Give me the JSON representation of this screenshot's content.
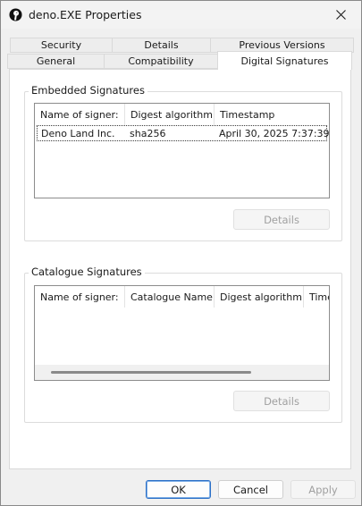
{
  "window": {
    "title": "deno.EXE Properties"
  },
  "tabs": {
    "row1": [
      {
        "label": "Security"
      },
      {
        "label": "Details"
      },
      {
        "label": "Previous Versions"
      }
    ],
    "row2": [
      {
        "label": "General"
      },
      {
        "label": "Compatibility"
      },
      {
        "label": "Digital Signatures",
        "active": true
      }
    ]
  },
  "embedded": {
    "title": "Embedded Signatures",
    "columns": [
      "Name of signer:",
      "Digest algorithm",
      "Timestamp"
    ],
    "rows": [
      [
        "Deno Land Inc.",
        "sha256",
        "April 30, 2025 7:37:39..."
      ]
    ],
    "details_button": "Details"
  },
  "catalogue": {
    "title": "Catalogue Signatures",
    "columns": [
      "Name of signer:",
      "Catalogue Name",
      "Digest algorithm",
      "Time"
    ],
    "rows": [],
    "details_button": "Details"
  },
  "footer": {
    "ok": "OK",
    "cancel": "Cancel",
    "apply": "Apply"
  }
}
